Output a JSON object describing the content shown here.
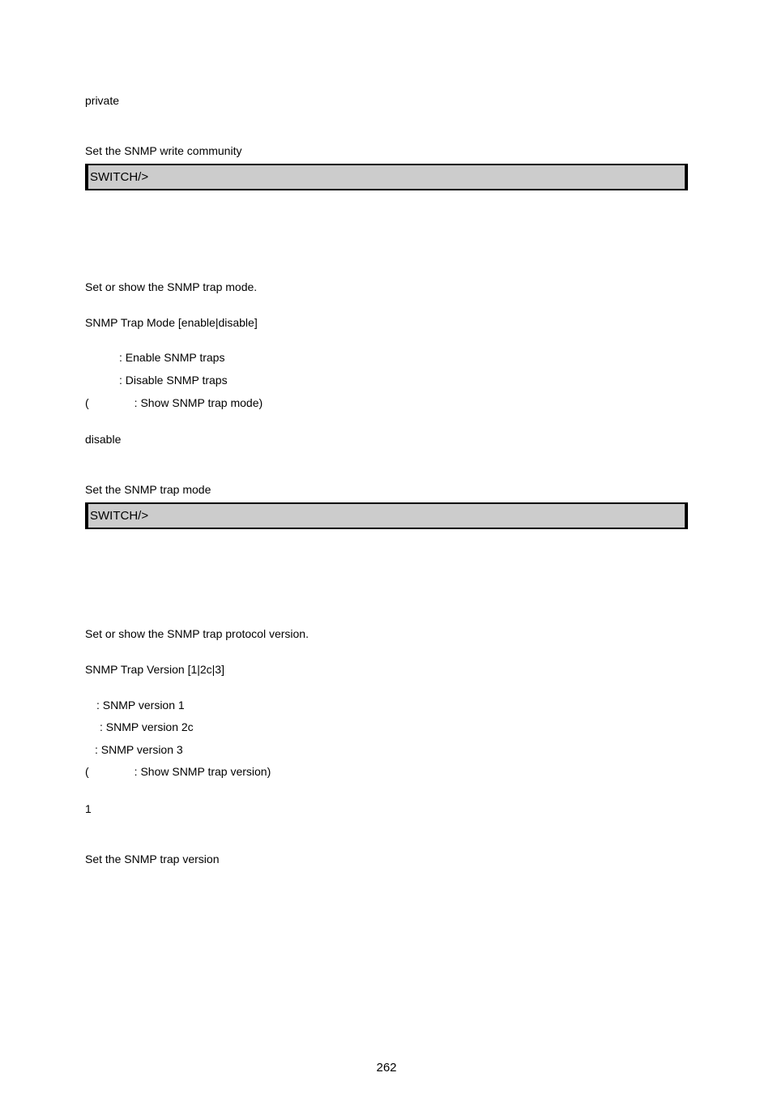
{
  "block1": {
    "default_value": "private",
    "example_label": "Set the SNMP write community",
    "prompt": "SWITCH/>"
  },
  "block2": {
    "description": "Set or show the SNMP trap mode.",
    "syntax": "SNMP Trap Mode [enable|disable]",
    "params": {
      "enable": ": Enable SNMP traps",
      "disable": ": Disable SNMP traps",
      "default_open": "(",
      "default_text": ": Show SNMP trap mode)"
    },
    "default_value": "disable",
    "example_label": "Set the SNMP trap mode",
    "prompt": "SWITCH/>"
  },
  "block3": {
    "description": "Set or show the SNMP trap protocol version.",
    "syntax": "SNMP Trap Version [1|2c|3]",
    "params": {
      "v1": ": SNMP version 1",
      "v2c": ": SNMP version 2c",
      "v3": ": SNMP version 3",
      "default_open": "(",
      "default_text": ": Show SNMP trap version)"
    },
    "default_value": "1",
    "example_label": "Set the SNMP trap version"
  },
  "page_number": "262"
}
